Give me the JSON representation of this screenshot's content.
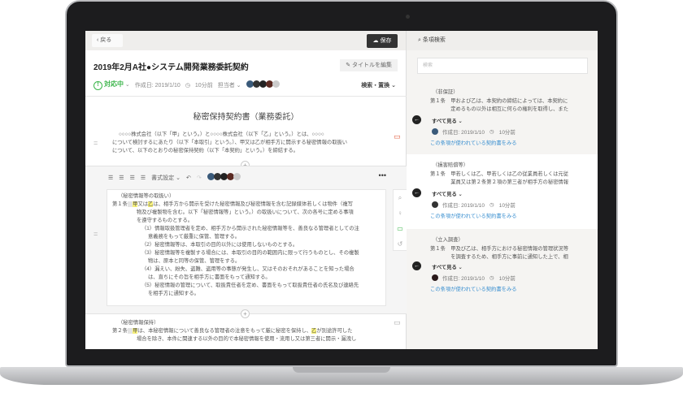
{
  "topbar": {
    "back": "戻る",
    "save": "保存"
  },
  "doc": {
    "title": "2019年2月A社●システム開発業務委託契約",
    "edit_title": "タイトルを編集",
    "status": "対応中",
    "created": "作成日: 2019/1/10",
    "updated": "10分前",
    "assignee": "担当者",
    "search_replace": "検索・置換",
    "heading": "秘密保持契約書（業務委託）",
    "preamble": [
      "○○○○株式会社（以下「甲」という。）と○○○○株式会社（以下「乙」という。）とは、○○○○",
      "について検討するにあたり（以下「本取引」という。）、甲又は乙が相手方に開示する秘密情報の取扱い",
      "について、以下のとおりの秘密保持契約（以下「本契約」という。）を締結する。"
    ],
    "toolbar": {
      "format": "書式設定"
    },
    "art1": {
      "heading": "（秘密情報等の取扱い）",
      "label": "第１条",
      "p1": "甲",
      "p2": "乙",
      "lines": [
        "は、相手方から開示を受けた秘密情報及び秘密情報を含む記録媒体若しくは物件（複写",
        "物及び複製物を含む。以下「秘密情報等」という。）の取扱いについて、次の各号に定める事項",
        "を遵守するものとする。",
        "（1）情報取扱管理者を定め、相手方から開示された秘密情報等を、善良なる管理者としての注",
        "意義務をもって厳重に保管、管理する。",
        "（2）秘密情報等は、本取引の目的以外には使用しないものとする。",
        "（3）秘密情報等を複製する場合には、本取引の目的の範囲内に限って行うものとし、その複製",
        "物は、原本と同等の保管、管理をする。",
        "（4）漏えい、紛失、盗難、盗用等の事態が発生し、又はそのおそれがあることを知った場合",
        "は、直ちにその旨を相手方に書面をもって通知する。",
        "（5）秘密情報の管理について、取扱責任者を定め、書面をもって取扱責任者の氏名及び連絡先",
        "を相手方に通知する。"
      ]
    },
    "art2": {
      "heading": "（秘密情報保持）",
      "label": "第２条",
      "line1": "は、本秘密情報について善良なる管理者の注意をもって厳に秘密を保持し、",
      "line1b": "が別途許可した",
      "line2": "場合を除き、本件に関連する以外の目的で本秘密情報を使用・流用し又は第三者に開示・漏洩し"
    }
  },
  "panel": {
    "title": "条項検索",
    "search_placeholder": "検索",
    "see_all": "すべて見る",
    "created": "作成日: 2019/1/10",
    "updated": "10分前",
    "link": "この条項が使われている契約書をみる",
    "cards": [
      {
        "heading": "（非保証）",
        "lines": [
          "第１条　甲および乙は、本契約の締結によっては、本契約に",
          "　　　　定めるもの以外は相互に何らの権利を取得し、また"
        ]
      },
      {
        "heading": "（損害賠償等）",
        "lines": [
          "第１条　甲若しくは乙、甲若しくは乙の従業員若しくは元従",
          "　　　　業員又は第２条第２項の第三者が相手方の秘密情報"
        ]
      },
      {
        "heading": "（立入調査）",
        "lines": [
          "第１条　甲及び乙は、相手方における秘密情報の管理状況等",
          "　　　　を調査するため、相手方に事前に通知した上で、相"
        ]
      }
    ]
  },
  "colors": {
    "status": "#3bb54a",
    "link": "#3a8fd0",
    "highlight": "#f5ef7a"
  }
}
